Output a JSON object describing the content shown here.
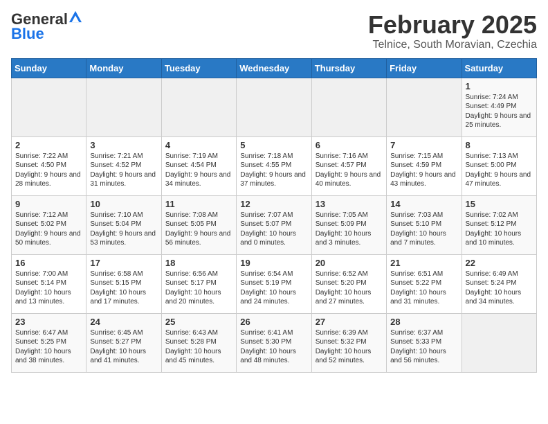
{
  "header": {
    "logo_general": "General",
    "logo_blue": "Blue",
    "title": "February 2025",
    "subtitle": "Telnice, South Moravian, Czechia"
  },
  "days_of_week": [
    "Sunday",
    "Monday",
    "Tuesday",
    "Wednesday",
    "Thursday",
    "Friday",
    "Saturday"
  ],
  "weeks": [
    [
      {
        "day": "",
        "detail": ""
      },
      {
        "day": "",
        "detail": ""
      },
      {
        "day": "",
        "detail": ""
      },
      {
        "day": "",
        "detail": ""
      },
      {
        "day": "",
        "detail": ""
      },
      {
        "day": "",
        "detail": ""
      },
      {
        "day": "1",
        "detail": "Sunrise: 7:24 AM\nSunset: 4:49 PM\nDaylight: 9 hours and 25 minutes."
      }
    ],
    [
      {
        "day": "2",
        "detail": "Sunrise: 7:22 AM\nSunset: 4:50 PM\nDaylight: 9 hours and 28 minutes."
      },
      {
        "day": "3",
        "detail": "Sunrise: 7:21 AM\nSunset: 4:52 PM\nDaylight: 9 hours and 31 minutes."
      },
      {
        "day": "4",
        "detail": "Sunrise: 7:19 AM\nSunset: 4:54 PM\nDaylight: 9 hours and 34 minutes."
      },
      {
        "day": "5",
        "detail": "Sunrise: 7:18 AM\nSunset: 4:55 PM\nDaylight: 9 hours and 37 minutes."
      },
      {
        "day": "6",
        "detail": "Sunrise: 7:16 AM\nSunset: 4:57 PM\nDaylight: 9 hours and 40 minutes."
      },
      {
        "day": "7",
        "detail": "Sunrise: 7:15 AM\nSunset: 4:59 PM\nDaylight: 9 hours and 43 minutes."
      },
      {
        "day": "8",
        "detail": "Sunrise: 7:13 AM\nSunset: 5:00 PM\nDaylight: 9 hours and 47 minutes."
      }
    ],
    [
      {
        "day": "9",
        "detail": "Sunrise: 7:12 AM\nSunset: 5:02 PM\nDaylight: 9 hours and 50 minutes."
      },
      {
        "day": "10",
        "detail": "Sunrise: 7:10 AM\nSunset: 5:04 PM\nDaylight: 9 hours and 53 minutes."
      },
      {
        "day": "11",
        "detail": "Sunrise: 7:08 AM\nSunset: 5:05 PM\nDaylight: 9 hours and 56 minutes."
      },
      {
        "day": "12",
        "detail": "Sunrise: 7:07 AM\nSunset: 5:07 PM\nDaylight: 10 hours and 0 minutes."
      },
      {
        "day": "13",
        "detail": "Sunrise: 7:05 AM\nSunset: 5:09 PM\nDaylight: 10 hours and 3 minutes."
      },
      {
        "day": "14",
        "detail": "Sunrise: 7:03 AM\nSunset: 5:10 PM\nDaylight: 10 hours and 7 minutes."
      },
      {
        "day": "15",
        "detail": "Sunrise: 7:02 AM\nSunset: 5:12 PM\nDaylight: 10 hours and 10 minutes."
      }
    ],
    [
      {
        "day": "16",
        "detail": "Sunrise: 7:00 AM\nSunset: 5:14 PM\nDaylight: 10 hours and 13 minutes."
      },
      {
        "day": "17",
        "detail": "Sunrise: 6:58 AM\nSunset: 5:15 PM\nDaylight: 10 hours and 17 minutes."
      },
      {
        "day": "18",
        "detail": "Sunrise: 6:56 AM\nSunset: 5:17 PM\nDaylight: 10 hours and 20 minutes."
      },
      {
        "day": "19",
        "detail": "Sunrise: 6:54 AM\nSunset: 5:19 PM\nDaylight: 10 hours and 24 minutes."
      },
      {
        "day": "20",
        "detail": "Sunrise: 6:52 AM\nSunset: 5:20 PM\nDaylight: 10 hours and 27 minutes."
      },
      {
        "day": "21",
        "detail": "Sunrise: 6:51 AM\nSunset: 5:22 PM\nDaylight: 10 hours and 31 minutes."
      },
      {
        "day": "22",
        "detail": "Sunrise: 6:49 AM\nSunset: 5:24 PM\nDaylight: 10 hours and 34 minutes."
      }
    ],
    [
      {
        "day": "23",
        "detail": "Sunrise: 6:47 AM\nSunset: 5:25 PM\nDaylight: 10 hours and 38 minutes."
      },
      {
        "day": "24",
        "detail": "Sunrise: 6:45 AM\nSunset: 5:27 PM\nDaylight: 10 hours and 41 minutes."
      },
      {
        "day": "25",
        "detail": "Sunrise: 6:43 AM\nSunset: 5:28 PM\nDaylight: 10 hours and 45 minutes."
      },
      {
        "day": "26",
        "detail": "Sunrise: 6:41 AM\nSunset: 5:30 PM\nDaylight: 10 hours and 48 minutes."
      },
      {
        "day": "27",
        "detail": "Sunrise: 6:39 AM\nSunset: 5:32 PM\nDaylight: 10 hours and 52 minutes."
      },
      {
        "day": "28",
        "detail": "Sunrise: 6:37 AM\nSunset: 5:33 PM\nDaylight: 10 hours and 56 minutes."
      },
      {
        "day": "",
        "detail": ""
      }
    ]
  ]
}
